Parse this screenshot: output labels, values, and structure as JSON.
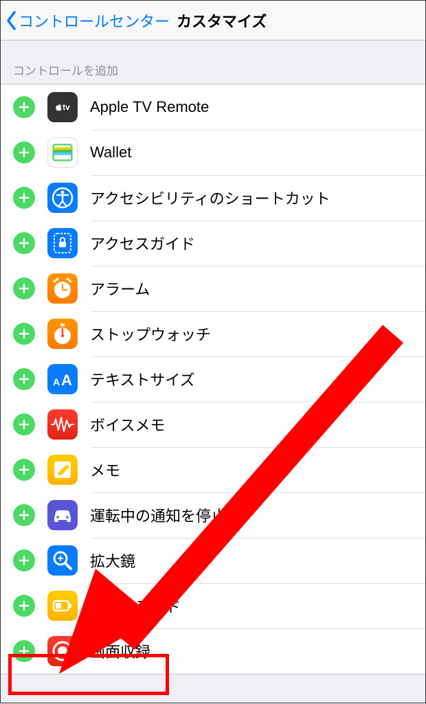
{
  "nav": {
    "back_label": "コントロールセンター",
    "title": "カスタマイズ"
  },
  "section_header": "コントロールを追加",
  "rows": [
    {
      "id": "appletv",
      "label": "Apple TV Remote"
    },
    {
      "id": "wallet",
      "label": "Wallet"
    },
    {
      "id": "access",
      "label": "アクセシビリティのショートカット"
    },
    {
      "id": "guide",
      "label": "アクセスガイド"
    },
    {
      "id": "alarm",
      "label": "アラーム"
    },
    {
      "id": "stopwatch",
      "label": "ストップウォッチ"
    },
    {
      "id": "textsize",
      "label": "テキストサイズ"
    },
    {
      "id": "voicememo",
      "label": "ボイスメモ"
    },
    {
      "id": "notes",
      "label": "メモ"
    },
    {
      "id": "dnd-drive",
      "label": "運転中の通知を停止"
    },
    {
      "id": "magnifier",
      "label": "拡大鏡"
    },
    {
      "id": "lowpower",
      "label": "低電力モード"
    },
    {
      "id": "screenrec",
      "label": "画面収録"
    }
  ],
  "colors": {
    "accent": "#007aff",
    "add_green": "#4cd964",
    "annotation_red": "#ff0000"
  },
  "highlight_row": "screenrec"
}
